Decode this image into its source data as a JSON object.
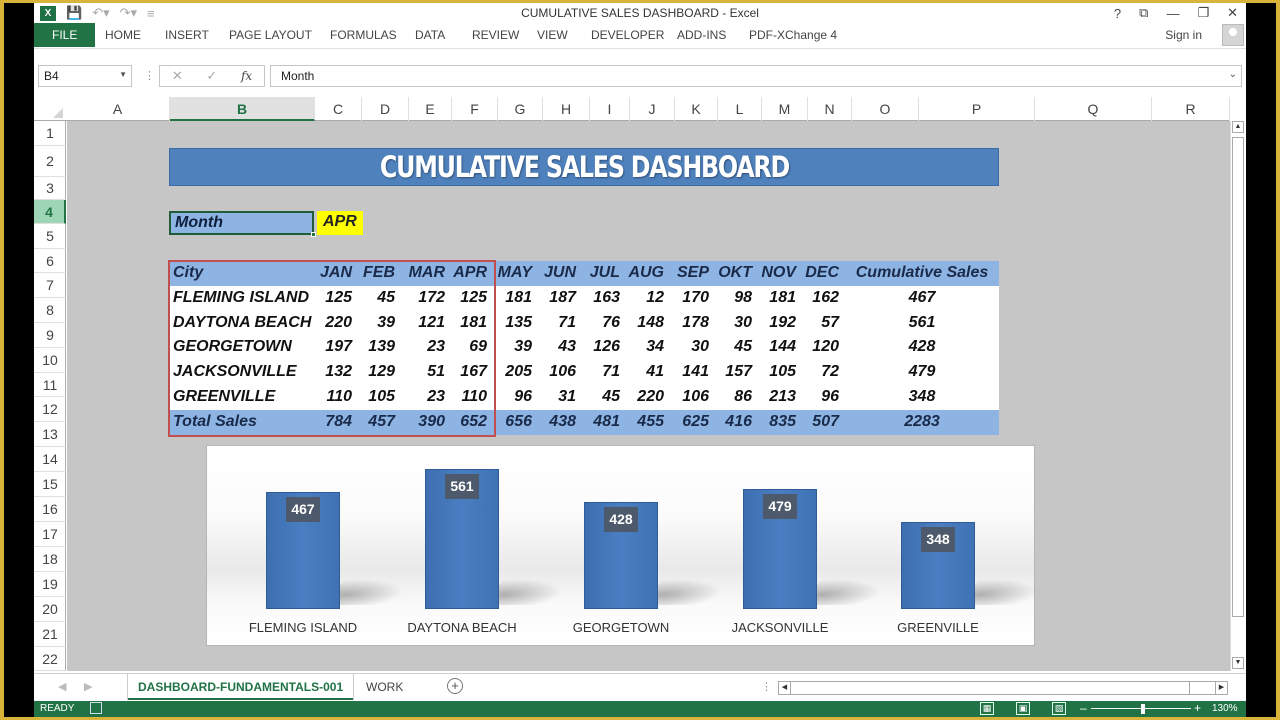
{
  "window": {
    "title": "CUMULATIVE SALES DASHBOARD - Excel",
    "controls": [
      "?",
      "⧉",
      "—",
      "❐",
      "✕"
    ]
  },
  "qat": {
    "logo": "X",
    "icons": [
      "save-icon",
      "undo-icon",
      "redo-icon",
      "customize-icon"
    ]
  },
  "ribbon": {
    "tabs": [
      "FILE",
      "HOME",
      "INSERT",
      "PAGE LAYOUT",
      "FORMULAS",
      "DATA",
      "REVIEW",
      "VIEW",
      "DEVELOPER",
      "ADD-INS",
      "PDF-XChange 4"
    ],
    "sign_in": "Sign in"
  },
  "formula_bar": {
    "name_box": "B4",
    "cancel": "✕",
    "enter": "✓",
    "fx": "fx",
    "content": "Month"
  },
  "columns": [
    "A",
    "B",
    "C",
    "D",
    "E",
    "F",
    "G",
    "H",
    "I",
    "J",
    "K",
    "L",
    "M",
    "N",
    "O",
    "P",
    "Q",
    "R"
  ],
  "selected_column": "B",
  "rows": [
    "1",
    "2",
    "3",
    "4",
    "5",
    "6",
    "7",
    "8",
    "9",
    "10",
    "11",
    "12",
    "13",
    "14",
    "15",
    "16",
    "17",
    "18",
    "19",
    "20",
    "21",
    "22"
  ],
  "selected_row": "4",
  "dashboard": {
    "title": "CUMULATIVE SALES DASHBOARD",
    "month_label": "Month",
    "month_value": "APR",
    "table": {
      "headers": [
        "City",
        "JAN",
        "FEB",
        "MAR",
        "APR",
        "MAY",
        "JUN",
        "JUL",
        "AUG",
        "SEP",
        "OKT",
        "NOV",
        "DEC",
        "Cumulative Sales"
      ],
      "rows": [
        [
          "FLEMING ISLAND",
          "125",
          "45",
          "172",
          "125",
          "181",
          "187",
          "163",
          "12",
          "170",
          "98",
          "181",
          "162",
          "467"
        ],
        [
          "DAYTONA BEACH",
          "220",
          "39",
          "121",
          "181",
          "135",
          "71",
          "76",
          "148",
          "178",
          "30",
          "192",
          "57",
          "561"
        ],
        [
          "GEORGETOWN",
          "197",
          "139",
          "23",
          "69",
          "39",
          "43",
          "126",
          "34",
          "30",
          "45",
          "144",
          "120",
          "428"
        ],
        [
          "JACKSONVILLE",
          "132",
          "129",
          "51",
          "167",
          "205",
          "106",
          "71",
          "41",
          "141",
          "157",
          "105",
          "72",
          "479"
        ],
        [
          "GREENVILLE",
          "110",
          "105",
          "23",
          "110",
          "96",
          "31",
          "45",
          "220",
          "106",
          "86",
          "213",
          "96",
          "348"
        ]
      ],
      "total": [
        "Total Sales",
        "784",
        "457",
        "390",
        "652",
        "656",
        "438",
        "481",
        "455",
        "625",
        "416",
        "835",
        "507",
        "2283"
      ]
    },
    "colors": {
      "banner": "#4f81bd",
      "header_fill": "#8db4e2",
      "month_value_fill": "#ffff00",
      "highlight_border": "#c0504d",
      "bar": "#4a7ec2",
      "data_label_bg": "#4d5a6c"
    }
  },
  "chart_data": {
    "type": "bar",
    "title": "",
    "categories": [
      "FLEMING ISLAND",
      "DAYTONA BEACH",
      "GEORGETOWN",
      "JACKSONVILLE",
      "GREENVILLE"
    ],
    "values": [
      467,
      561,
      428,
      479,
      348
    ],
    "xlabel": "",
    "ylabel": "",
    "ylim": [
      0,
      600
    ],
    "grid": false,
    "legend": "none",
    "data_labels": true
  },
  "sheet_tabs": {
    "tabs": [
      "DASHBOARD-FUNDAMENTALS-001",
      "WORK"
    ],
    "active": "DASHBOARD-FUNDAMENTALS-001",
    "add": "+"
  },
  "status": {
    "ready": "READY",
    "zoom": "130%",
    "zoom_level": 130
  }
}
